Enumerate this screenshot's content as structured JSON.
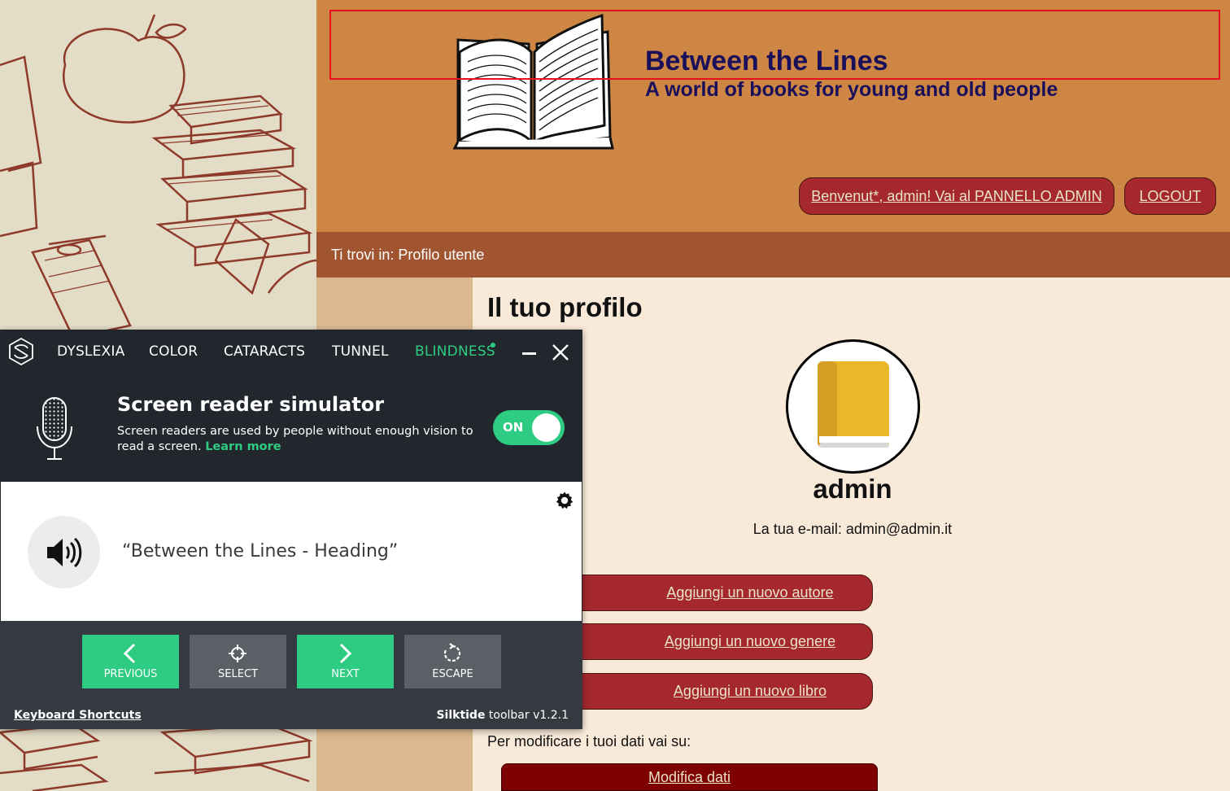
{
  "header": {
    "title": "Between the Lines",
    "subtitle": "A world of books for young and old people",
    "admin_link": "Benvenut*, admin! Vai al PANNELLO ADMIN",
    "logout_link": "LOGOUT"
  },
  "breadcrumb": "Ti trovi in: Profilo utente",
  "profile": {
    "heading": "Il tuo profilo",
    "username": "admin",
    "email_line": "La tua e-mail: admin@admin.it",
    "actions": [
      "Aggiungi un nuovo autore",
      "Aggiungi un nuovo genere",
      "Aggiungi un nuovo libro"
    ],
    "edit_intro": "Per modificare i tuoi dati vai su:",
    "edit_button": "Modifica dati"
  },
  "toolbar": {
    "tabs": [
      "DYSLEXIA",
      "COLOR",
      "CATARACTS",
      "TUNNEL",
      "BLINDNESS"
    ],
    "active_tab": "BLINDNESS",
    "sr_title": "Screen reader simulator",
    "sr_desc": "Screen readers are used by people without enough vision to read a screen.",
    "learn_more": "Learn more",
    "toggle_label": "ON",
    "spoken_text": "“Between the Lines - Heading”",
    "controls": {
      "previous": "PREVIOUS",
      "select": "SELECT",
      "next": "NEXT",
      "escape": "ESCAPE"
    },
    "keyboard_shortcuts": "Keyboard Shortcuts",
    "brand": "Silktide",
    "version": "toolbar v1.2.1"
  },
  "colors": {
    "header_bg": "#cd8643",
    "breadcrumb_bg": "#a05530",
    "button_bg": "#a4282d",
    "accent_green": "#2ecc83",
    "toolbar_bg": "#22272d"
  }
}
